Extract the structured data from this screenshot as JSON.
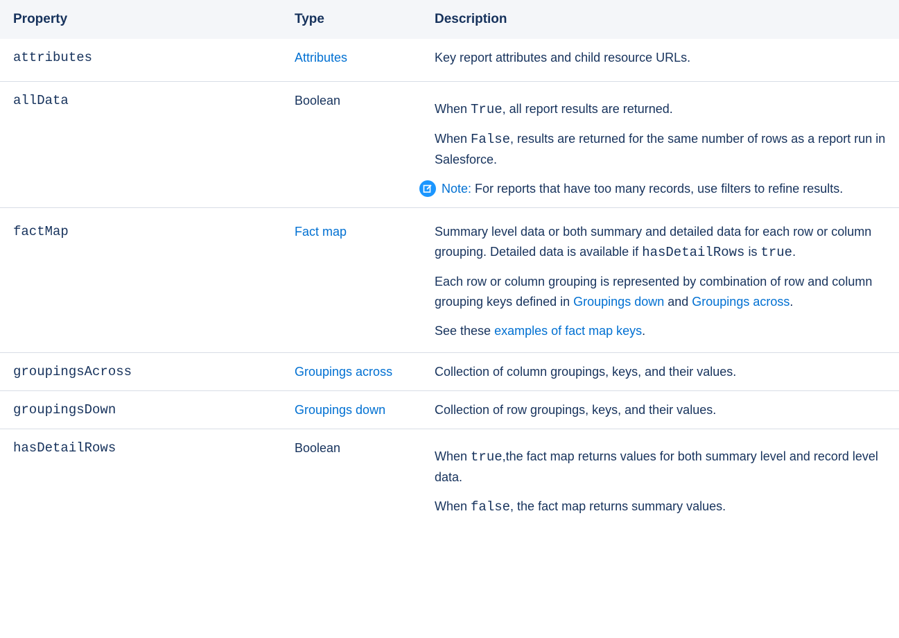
{
  "headers": {
    "property": "Property",
    "type": "Type",
    "description": "Description"
  },
  "rows": {
    "attributes": {
      "property": "attributes",
      "type": "Attributes",
      "desc": "Key report attributes and child resource URLs."
    },
    "allData": {
      "property": "allData",
      "type": "Boolean",
      "p1_pre": "When ",
      "p1_code": "True",
      "p1_post": ", all report results are returned.",
      "p2_pre": "When ",
      "p2_code": "False",
      "p2_post": ", results are returned for the same number of rows as a report run in Salesforce.",
      "note_label": "Note:",
      "note_text": " For reports that have too many records, use filters to refine results."
    },
    "factMap": {
      "property": "factMap",
      "type": "Fact map",
      "p1_pre": "Summary level data or both summary and detailed data for each row or column grouping. Detailed data is available if ",
      "p1_code": "hasDetailRows",
      "p1_mid": " is ",
      "p1_code2": "true",
      "p1_post": ".",
      "p2_pre": "Each row or column grouping is represented by combination of row and column grouping keys defined in ",
      "p2_link1": "Groupings down",
      "p2_mid": " and ",
      "p2_link2": "Groupings across",
      "p2_post": ".",
      "p3_pre": "See these ",
      "p3_link": "examples of fact map keys",
      "p3_post": "."
    },
    "groupingsAcross": {
      "property": "groupingsAcross",
      "type": "Groupings across",
      "desc": "Collection of column groupings, keys, and their values."
    },
    "groupingsDown": {
      "property": "groupingsDown",
      "type": "Groupings down",
      "desc": "Collection of row groupings, keys, and their values."
    },
    "hasDetailRows": {
      "property": "hasDetailRows",
      "type": "Boolean",
      "p1_pre": "When ",
      "p1_code": "true",
      "p1_post": ",the fact map returns values for both summary level and record level data.",
      "p2_pre": "When ",
      "p2_code": "false",
      "p2_post": ", the fact map returns summary values."
    }
  },
  "colors": {
    "link": "#0070d2",
    "text": "#16325c",
    "header_bg": "#f4f6f9",
    "note_icon": "#1b96ff"
  },
  "icons": {
    "note": "note-edit-icon"
  }
}
